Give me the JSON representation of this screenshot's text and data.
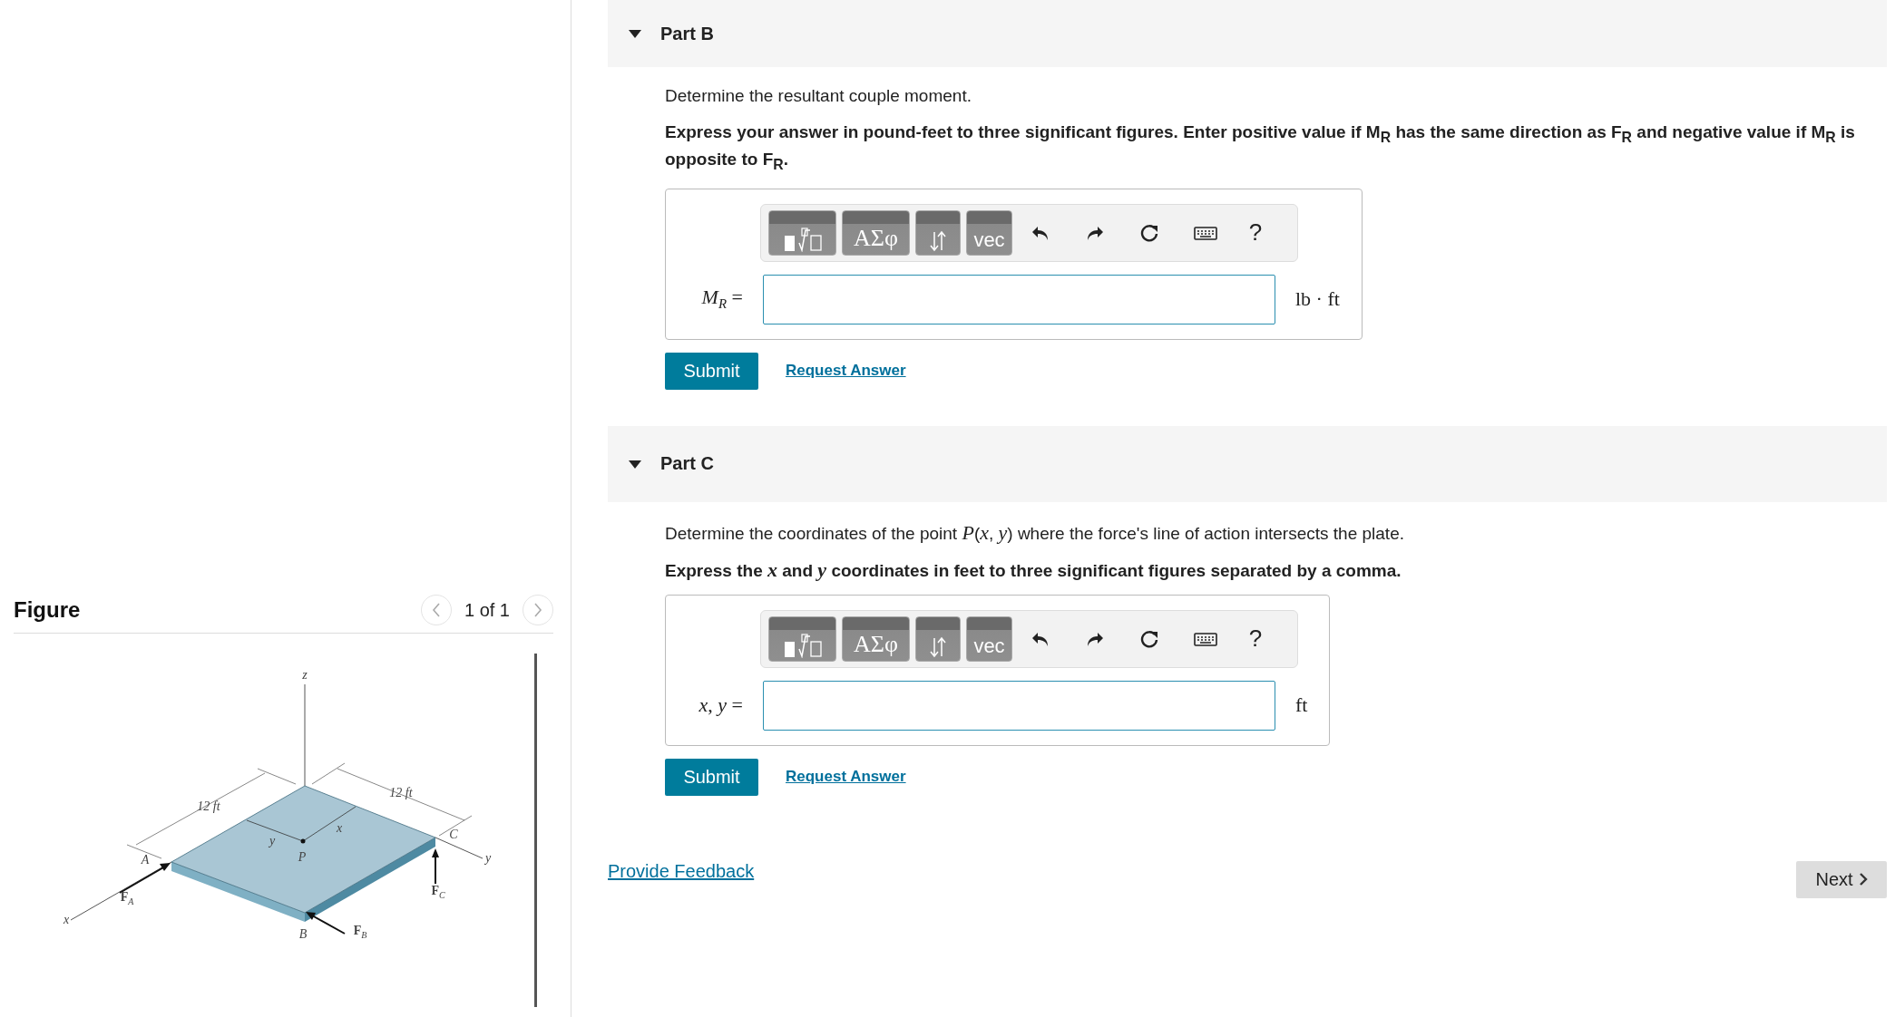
{
  "figure_panel": {
    "title": "Figure",
    "counter": "1 of 1",
    "diagram": {
      "labels": [
        "z",
        "12 ft",
        "12 ft",
        "y",
        "x",
        "C",
        "A",
        "P",
        "y",
        "F$_{A}$",
        "F$_{C}$",
        "x",
        "B",
        "F$_{B}$"
      ]
    }
  },
  "parts": [
    {
      "title": "Part B",
      "expanded": true,
      "prompt": "Determine the resultant couple moment.",
      "instruction": "Express your answer in pound-feet to three significant figures. Enter positive value if M$_{R}$ has the same direction as F$_{R}$ and negative value if M$_{R}$ is opposite to F$_{R}$.",
      "toolbar": [
        {
          "kind": "templates"
        },
        {
          "kind": "symbols",
          "label": "ΑΣφ"
        },
        {
          "kind": "arrows"
        },
        {
          "kind": "vector",
          "label": "vec"
        },
        {
          "kind": "undo"
        },
        {
          "kind": "redo"
        },
        {
          "kind": "reset"
        },
        {
          "kind": "keyboard"
        },
        {
          "kind": "help",
          "label": "?"
        }
      ],
      "answer": {
        "label": "*M*$_{R}$ =",
        "unit": "lb · ft"
      },
      "submit": "Submit",
      "request": "Request Answer"
    },
    {
      "title": "Part C",
      "expanded": true,
      "prompt": "Determine the coordinates of the point *P*(*x*, *y*) where the force's line of action intersects the plate.",
      "instruction": "Express the *x* and *y* coordinates in feet to three significant figures separated by a comma.",
      "toolbar": [
        {
          "kind": "templates"
        },
        {
          "kind": "symbols",
          "label": "ΑΣφ"
        },
        {
          "kind": "arrows"
        },
        {
          "kind": "vector",
          "label": "vec"
        },
        {
          "kind": "undo"
        },
        {
          "kind": "redo"
        },
        {
          "kind": "reset"
        },
        {
          "kind": "keyboard"
        },
        {
          "kind": "help",
          "label": "?"
        }
      ],
      "answer": {
        "label": "*x*, *y* =",
        "unit": "ft"
      },
      "submit": "Submit",
      "request": "Request Answer"
    }
  ],
  "feedback_link": "Provide Feedback",
  "next_button": "Next"
}
